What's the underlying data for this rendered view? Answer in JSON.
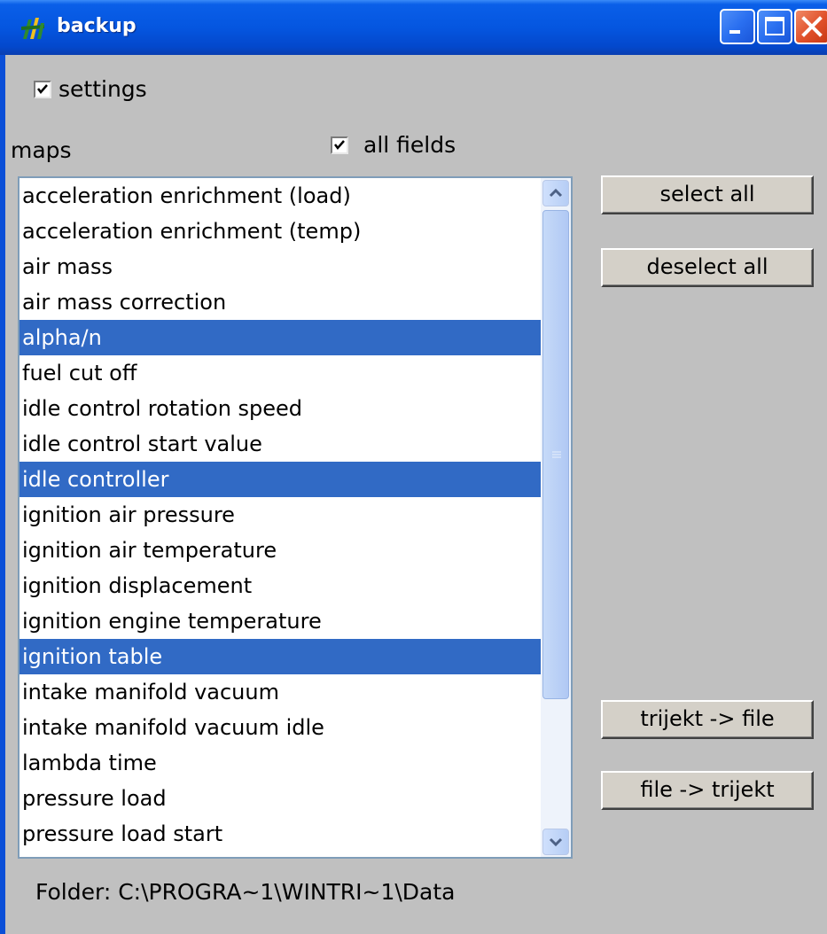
{
  "window": {
    "title": "backup",
    "app_icon": "wintrijekt-app-icon",
    "controls": [
      "minimize-icon",
      "maximize-icon",
      "close-icon"
    ]
  },
  "settings_checkbox": {
    "label": "settings",
    "checked": true
  },
  "maps_label": "maps",
  "all_fields_checkbox": {
    "label": "all fields",
    "checked": true
  },
  "maps_list": {
    "items": [
      {
        "label": "acceleration enrichment (load)",
        "selected": false
      },
      {
        "label": "acceleration enrichment (temp)",
        "selected": false
      },
      {
        "label": "air mass",
        "selected": false
      },
      {
        "label": "air mass correction",
        "selected": false
      },
      {
        "label": "alpha/n",
        "selected": true
      },
      {
        "label": "fuel cut off",
        "selected": false
      },
      {
        "label": "idle control rotation speed",
        "selected": false
      },
      {
        "label": "idle control start value",
        "selected": false
      },
      {
        "label": "idle controller",
        "selected": true
      },
      {
        "label": "ignition air pressure",
        "selected": false
      },
      {
        "label": "ignition air temperature",
        "selected": false
      },
      {
        "label": "ignition displacement",
        "selected": false
      },
      {
        "label": "ignition engine temperature",
        "selected": false
      },
      {
        "label": "ignition table",
        "selected": true
      },
      {
        "label": "intake manifold vacuum",
        "selected": false
      },
      {
        "label": "intake manifold vacuum idle",
        "selected": false
      },
      {
        "label": "lambda time",
        "selected": false
      },
      {
        "label": "pressure load",
        "selected": false
      },
      {
        "label": "pressure load start",
        "selected": false
      }
    ],
    "selection_color": "#316ac5"
  },
  "buttons": {
    "select_all": "select all",
    "deselect_all": "deselect all",
    "trijekt_to_file": "trijekt -> file",
    "file_to_trijekt": "file -> trijekt"
  },
  "folder": "Folder:  C:\\PROGRA~1\\WINTRI~1\\Data"
}
